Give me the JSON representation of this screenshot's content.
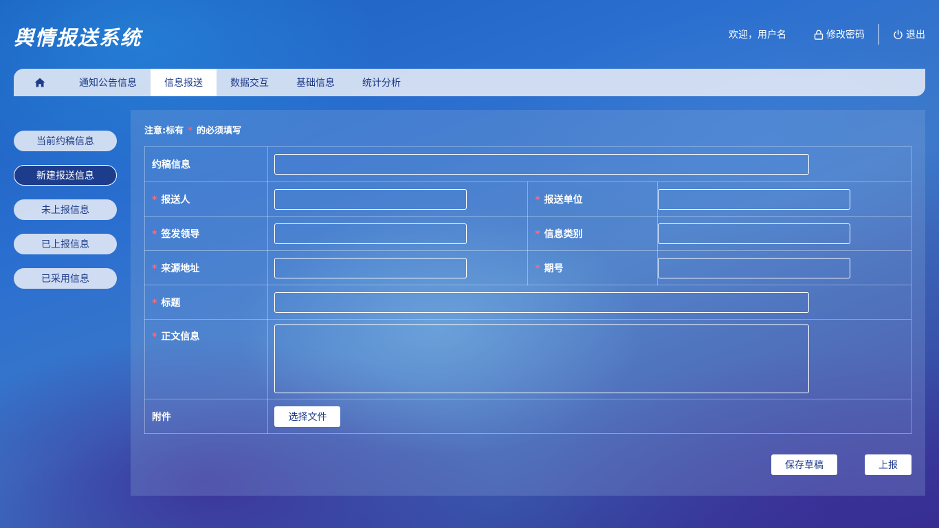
{
  "app": {
    "title": "舆情报送系统"
  },
  "header": {
    "welcome": "欢迎，用户名",
    "change_password": "修改密码",
    "logout": "退出"
  },
  "nav": {
    "home_icon": "home-icon",
    "tabs": [
      {
        "label": "通知公告信息",
        "active": false
      },
      {
        "label": "信息报送",
        "active": true
      },
      {
        "label": "数据交互",
        "active": false
      },
      {
        "label": "基础信息",
        "active": false
      },
      {
        "label": "统计分析",
        "active": false
      }
    ]
  },
  "sidebar": {
    "items": [
      {
        "label": "当前约稿信息",
        "active": false
      },
      {
        "label": "新建报送信息",
        "active": true
      },
      {
        "label": "未上报信息",
        "active": false
      },
      {
        "label": "已上报信息",
        "active": false
      },
      {
        "label": "已采用信息",
        "active": false
      }
    ]
  },
  "form": {
    "note_prefix": "注意:标有",
    "required_mark": "*",
    "note_suffix": "的必须填写",
    "fields": {
      "draft_info": {
        "label": "约稿信息",
        "value": ""
      },
      "reporter": {
        "label": "报送人",
        "value": ""
      },
      "report_unit": {
        "label": "报送单位",
        "value": ""
      },
      "issuing_leader": {
        "label": "签发领导",
        "value": ""
      },
      "info_category": {
        "label": "信息类别",
        "value": ""
      },
      "source_address": {
        "label": "来源地址",
        "value": ""
      },
      "issue_number": {
        "label": "期号",
        "value": ""
      },
      "title": {
        "label": "标题",
        "value": ""
      },
      "body": {
        "label": "正文信息",
        "value": ""
      },
      "attachment": {
        "label": "附件",
        "button": "选择文件"
      }
    },
    "actions": {
      "save_draft": "保存草稿",
      "submit": "上报"
    }
  },
  "colors": {
    "accent": "#1d3b8a",
    "required": "#ff6b7a",
    "nav_bg": "#e1e8f5"
  }
}
